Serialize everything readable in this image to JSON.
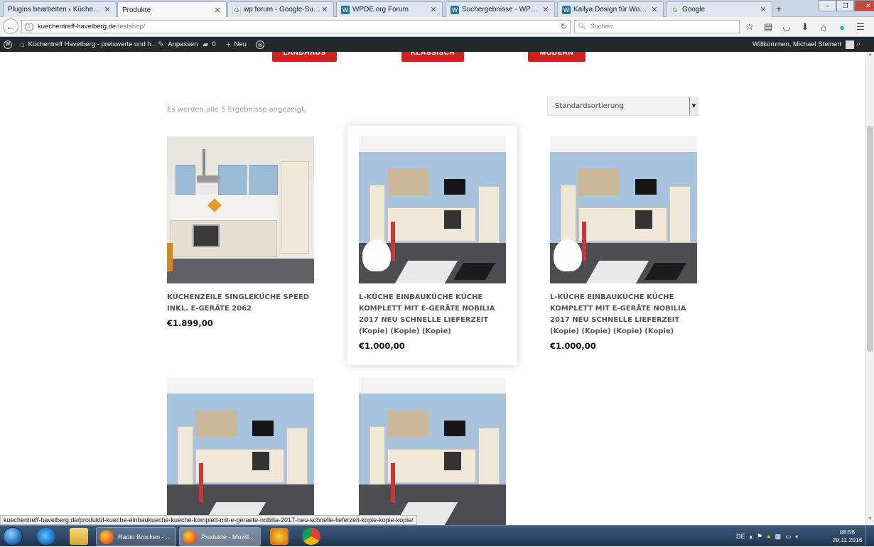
{
  "browser": {
    "tabs": [
      {
        "label": "Plugins bearbeiten ‹ Küchentre...",
        "favicon": "wp-icon",
        "active": false
      },
      {
        "label": "Produkte",
        "favicon": "none",
        "active": true
      },
      {
        "label": "wp forum - Google-Suche",
        "favicon": "google-icon",
        "active": false
      },
      {
        "label": "WPDE.org Forum",
        "favicon": "wp-icon",
        "active": false
      },
      {
        "label": "Suchergebnisse - WPDE.or...",
        "favicon": "wp-icon",
        "active": false
      },
      {
        "label": "Kallya Design für Woocom...",
        "favicon": "wp-icon",
        "active": false
      },
      {
        "label": "Google",
        "favicon": "google-icon",
        "active": false
      }
    ],
    "url_host": "kuechentreff-havelberg.de",
    "url_path": "/testshop/",
    "search_placeholder": "Suchen"
  },
  "adminbar": {
    "site_name": "Küchentreff Havelberg - preiswerte und h...",
    "customize": "Anpassen",
    "comments_count": "0",
    "new_label": "Neu",
    "welcome": "Willkommen, Michael Steinert"
  },
  "categories": [
    {
      "label": "LANDHAUS"
    },
    {
      "label": "KLASSISCH"
    },
    {
      "label": "MODERN"
    }
  ],
  "shop": {
    "result_count": "Es werden alle 5 Ergebnisse angezeigt.",
    "sort_selected": "Standardsortierung"
  },
  "products": [
    {
      "title": "Küchenzeile Singleküche SPEED inkl. E-Geräte 2062",
      "kopie": "",
      "price": "€1.899,00"
    },
    {
      "title": "L-Küche Einbauküche Küche komplett mit E-Geräte Nobilia 2017 neu schnelle Lieferzeit",
      "kopie": "(Kopie) (Kopie) (Kopie)",
      "price": "€1.000,00"
    },
    {
      "title": "L-Küche Einbauküche Küche komplett mit E-Geräte Nobilia 2017 neu schnelle Lieferzeit",
      "kopie": "(Kopie) (Kopie) (Kopie) (Kopie)",
      "price": "€1.000,00"
    },
    {
      "title": "",
      "kopie": "",
      "price": ""
    },
    {
      "title": "",
      "kopie": "",
      "price": ""
    }
  ],
  "status_url": "kuechentreff-havelberg.de/produkt/l-kueche-einbaukueche-kueche-komplett-mit-e-geraete-nobilia-2017-neu-schnelle-lieferzeit-kopie-kopie-kopie/",
  "taskbar": {
    "tasks": [
      {
        "label": "Radio Brocken - ..."
      },
      {
        "label": "Produkte - Mozill..."
      }
    ],
    "lang": "DE",
    "time": "08:56",
    "date": "29.11.2016"
  },
  "colors": {
    "accent_red": "#cd2122",
    "admin_bar": "#23282d"
  }
}
